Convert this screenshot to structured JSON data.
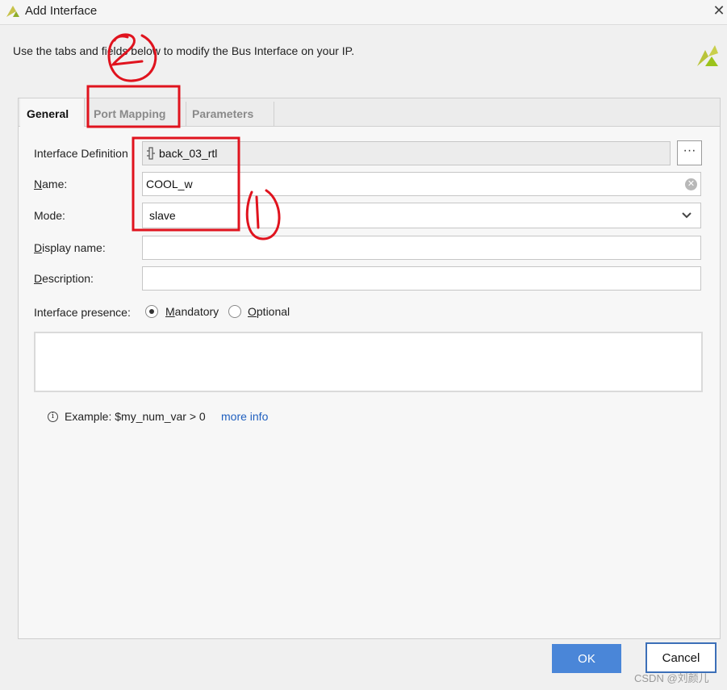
{
  "window": {
    "title": "Add Interface",
    "close_icon": "close-icon"
  },
  "intro_text": "Use the tabs and fields below to modify the Bus Interface on your IP.",
  "tabs": [
    {
      "label": "General",
      "active": true
    },
    {
      "label": "Port Mapping",
      "active": false
    },
    {
      "label": "Parameters",
      "active": false
    }
  ],
  "form": {
    "interface_definition": {
      "label": "Interface Definition",
      "value": "back_03_rtl",
      "icon": "bus-interface-icon",
      "browse_label": "···"
    },
    "name": {
      "label": "Name:",
      "value": "COOL_w"
    },
    "mode": {
      "label": "Mode:",
      "value": "slave"
    },
    "display_name": {
      "label": "Display name:",
      "value": ""
    },
    "description": {
      "label": "Description:",
      "value": ""
    },
    "presence": {
      "label": "Interface presence:",
      "options": [
        "Mandatory",
        "Optional"
      ],
      "selected": "Mandatory"
    }
  },
  "example": {
    "text": "Example:  $my_num_var > 0",
    "link": "more info"
  },
  "buttons": {
    "ok": "OK",
    "cancel": "Cancel"
  },
  "watermark": "CSDN @刘颜儿",
  "annotations": {
    "color": "#e0131e",
    "marks": [
      "②",
      "①"
    ]
  },
  "colors": {
    "primary_button": "#4a86d8",
    "link": "#1f5fbf",
    "brand_green": "#9bc31c"
  }
}
